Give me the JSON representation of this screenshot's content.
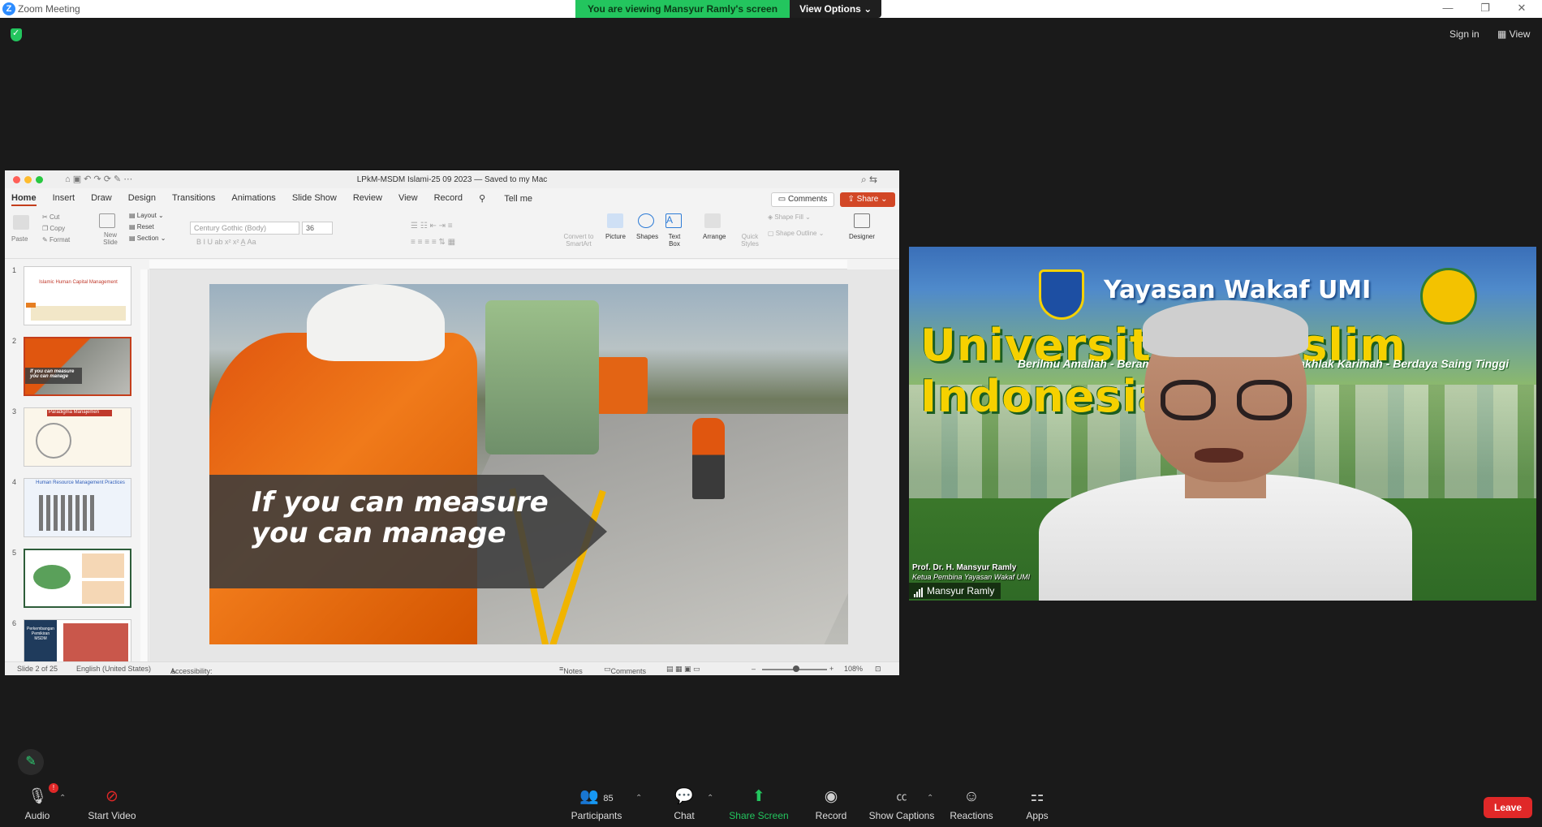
{
  "window": {
    "title": "Zoom Meeting"
  },
  "banner": {
    "message": "You are viewing Mansyur Ramly's screen",
    "view_options": "View Options"
  },
  "topright": {
    "sign_in": "Sign in",
    "view": "View"
  },
  "ppt": {
    "doc_title": "LPkM-MSDM Islami-25 09 2023 — Saved to my Mac",
    "tabs": [
      "Home",
      "Insert",
      "Draw",
      "Design",
      "Transitions",
      "Animations",
      "Slide Show",
      "Review",
      "View",
      "Record",
      "Tell me"
    ],
    "comments": "Comments",
    "share": "Share",
    "ribbon": {
      "paste": "Paste",
      "cut": "Cut",
      "copy": "Copy",
      "format": "Format",
      "new_slide": "New Slide",
      "layout": "Layout",
      "reset": "Reset",
      "section": "Section",
      "font": "Century Gothic (Body)",
      "size": "36",
      "convert": "Convert to SmartArt",
      "picture": "Picture",
      "shapes": "Shapes",
      "text_box": "Text Box",
      "arrange": "Arrange",
      "quick_styles": "Quick Styles",
      "shape_fill": "Shape Fill",
      "shape_outline": "Shape Outline",
      "designer": "Designer"
    },
    "thumbnails": [
      {
        "num": "1",
        "title": "Islamic Human Capital Management"
      },
      {
        "num": "2",
        "title": "If you can measure you can manage"
      },
      {
        "num": "3",
        "title": "Paradigma Manajemen"
      },
      {
        "num": "4",
        "title": "Human Resource Management Practices"
      },
      {
        "num": "5",
        "title": ""
      },
      {
        "num": "6",
        "title": "Perkembangan Pemikiran MSDM"
      }
    ],
    "slide_text_line1": "If you can measure",
    "slide_text_line2": "you can manage",
    "status": {
      "slide": "Slide 2 of 25",
      "language": "English (United States)",
      "accessibility": "Accessibility: Investigate",
      "notes": "Notes",
      "comments": "Comments",
      "zoom": "108%"
    }
  },
  "video": {
    "header1": "Yayasan Wakaf UMI",
    "header2": "Universitas Muslim Indonesia",
    "tagline_left": "Berilmu Amaliah - Beramal Ilmiah",
    "tagline_right": "Berakhlak Karimah - Berdaya Saing Tinggi",
    "caption_name": "Prof. Dr. H. Mansyur Ramly",
    "caption_role": "Ketua Pembina Yayasan Wakaf UMI",
    "participant_name": "Mansyur Ramly"
  },
  "toolbar": {
    "audio": "Audio",
    "start_video": "Start Video",
    "participants": "Participants",
    "participants_count": "85",
    "chat": "Chat",
    "share_screen": "Share Screen",
    "record": "Record",
    "show_captions": "Show Captions",
    "reactions": "Reactions",
    "apps": "Apps",
    "leave": "Leave"
  },
  "colors": {
    "zoom_blue": "#2d8cff",
    "share_green": "#23c55e",
    "leave_red": "#e02828",
    "ppt_accent": "#c43e1c"
  }
}
